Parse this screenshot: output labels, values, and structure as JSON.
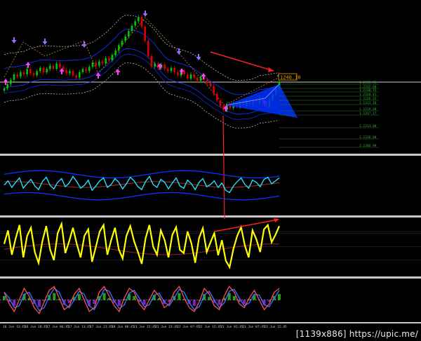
{
  "watermark": "[1139x886] https://upic.me/",
  "price_label": "1240.10",
  "fib_labels": [
    "1.2333.75",
    "1.2332.60",
    "1.2330.35",
    "1.2328.41",
    "1.2326.25",
    "1.2323.16",
    "1.2319.68",
    "1.2317.17",
    "1.2314.00",
    "1.2310.60",
    "1.2306.99"
  ],
  "x_ticks": [
    "16 Jun 13:45",
    "16 Jun 20:45",
    "17 Jun 06:45",
    "17 Jun 13:45",
    "17 Jun 23:45",
    "18 Jun 06:45",
    "21 Jun 15:45",
    "21 Jun 23:45",
    "22 Jun 07:45",
    "22 Jun 15:45",
    "23 Jun 01:45",
    "23 Jun 07:45",
    "23 Jun 15:45"
  ],
  "colors": {
    "bull_candle": "#00c800",
    "bear_candle": "#e00000",
    "fractal_up": "#9b6bff",
    "fractal_down": "#ff40ff",
    "arrow": "#ff2020",
    "harmonic": "#0030ff",
    "fib": "#2a7a2a",
    "rsi": "#ffff00",
    "cyan_line": "#20e0ff",
    "band": "#1030ff"
  },
  "chart_data": [
    {
      "type": "line",
      "name": "price",
      "y": [
        1218,
        1222,
        1226,
        1231,
        1229,
        1233,
        1231,
        1236,
        1232,
        1230,
        1234,
        1237,
        1233,
        1236,
        1239,
        1236,
        1241,
        1238,
        1235,
        1232,
        1234,
        1230,
        1228,
        1233,
        1236,
        1234,
        1238,
        1242,
        1239,
        1243,
        1241,
        1246,
        1244,
        1249,
        1253,
        1258,
        1262,
        1266,
        1271,
        1276,
        1280,
        1284,
        1275,
        1262,
        1248,
        1238,
        1241,
        1237,
        1240,
        1236,
        1234,
        1237,
        1233,
        1230,
        1234,
        1231,
        1227,
        1231,
        1228,
        1225,
        1229,
        1226,
        1223,
        1220,
        1213,
        1207,
        1202,
        1198,
        1203,
        1200,
        1204,
        1201,
        1205,
        1202,
        1206,
        1203,
        1207,
        1204,
        1209,
        1205,
        1201,
        1207,
        1212,
        1218,
        1224
      ]
    },
    {
      "type": "line",
      "name": "oscillator",
      "y": [
        50,
        62,
        44,
        58,
        70,
        42,
        55,
        66,
        48,
        38,
        60,
        72,
        50,
        40,
        58,
        68,
        46,
        56,
        74,
        60,
        42,
        50,
        64,
        36,
        48,
        62,
        70,
        44,
        52,
        68,
        58,
        40,
        54,
        72,
        62,
        46,
        38,
        60,
        74,
        52,
        44,
        66,
        58,
        40,
        56,
        70,
        48,
        42,
        64,
        54,
        38,
        58,
        68,
        46,
        52,
        62,
        44,
        56,
        36,
        30,
        48,
        60,
        70,
        52,
        42,
        64,
        58,
        46,
        66,
        72,
        54,
        62,
        70
      ]
    },
    {
      "type": "line",
      "name": "rsi",
      "y": [
        55,
        80,
        35,
        65,
        90,
        30,
        70,
        85,
        40,
        20,
        60,
        88,
        45,
        25,
        75,
        92,
        38,
        60,
        85,
        55,
        30,
        70,
        82,
        22,
        50,
        78,
        90,
        35,
        62,
        85,
        45,
        28,
        70,
        88,
        60,
        40,
        18,
        65,
        90,
        50,
        35,
        80,
        62,
        30,
        72,
        86,
        44,
        38,
        78,
        56,
        20,
        66,
        84,
        40,
        58,
        75,
        34,
        62,
        24,
        12,
        46,
        70,
        86,
        52,
        30,
        80,
        64,
        40,
        82,
        90,
        58,
        72,
        88
      ]
    },
    {
      "type": "line",
      "name": "stochastic",
      "y": [
        70,
        40,
        20,
        50,
        80,
        60,
        30,
        15,
        45,
        75,
        85,
        55,
        25,
        35,
        65,
        80,
        50,
        20,
        30,
        70,
        85,
        60,
        35,
        20,
        55,
        80,
        70,
        40,
        25,
        50,
        75,
        60,
        30,
        40,
        70,
        85,
        55,
        30,
        20,
        45,
        80,
        65,
        35,
        25,
        60,
        85,
        70,
        40,
        30,
        55,
        75,
        50,
        25,
        40,
        70,
        80
      ]
    }
  ]
}
